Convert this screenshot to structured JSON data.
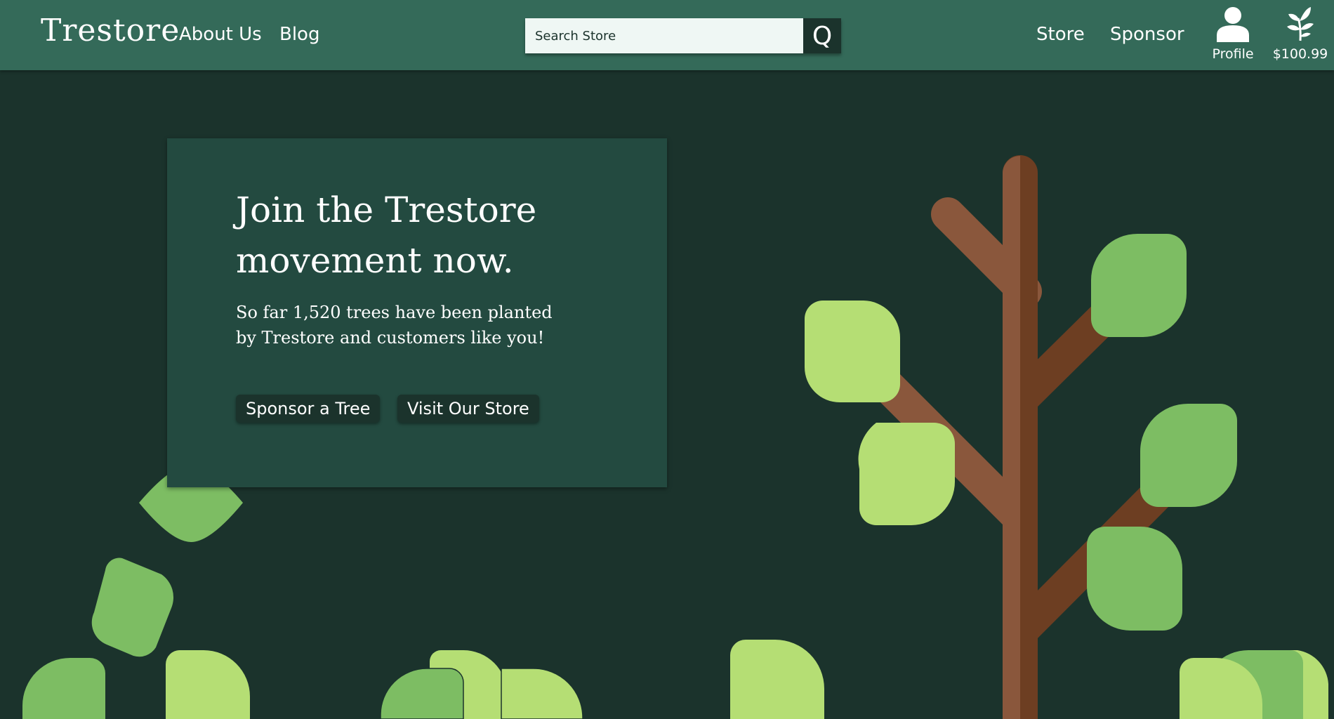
{
  "header": {
    "brand": "Trestore",
    "nav_left": [
      "About Us",
      "Blog"
    ],
    "search_placeholder": "Search Store",
    "search_button_label": "Q",
    "nav_right": [
      "Store",
      "Sponsor"
    ],
    "profile_label": "Profile",
    "balance_label": "$100.99"
  },
  "hero": {
    "title_line1": "Join the Trestore",
    "title_line2": "movement now.",
    "subtitle_line1": "So far 1,520 trees have been planted",
    "subtitle_line2": "by Trestore and customers like you!",
    "sponsor_button": "Sponsor a Tree",
    "store_button": "Visit Our Store"
  },
  "colors": {
    "header_bg": "#346a59",
    "page_bg": "#1b332c",
    "card_bg": "#234a40",
    "trunk": "#6d3e22",
    "branch": "#8a573c",
    "leaf_dark": "#7dbd63",
    "leaf_light": "#b5de74"
  }
}
